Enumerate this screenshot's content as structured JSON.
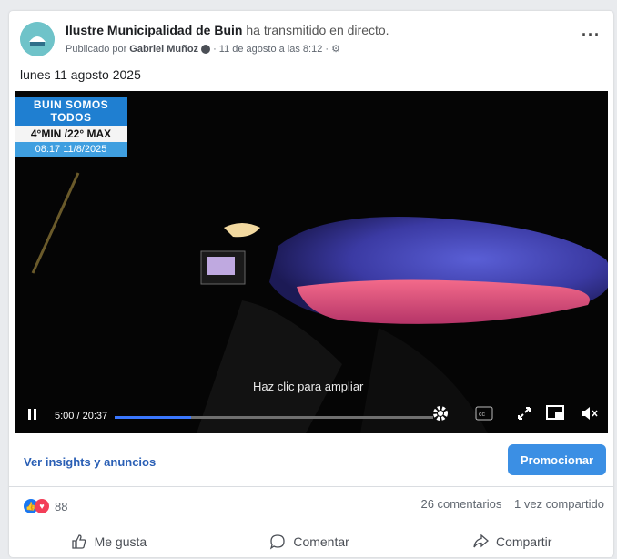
{
  "post": {
    "page_name": "Ilustre Municipalidad de Buin",
    "action": " ha transmitido en directo.",
    "published_by": "Publicado por",
    "author": "Gabriel Muñoz",
    "date": "· 11 de agosto a las 8:12 ·",
    "text": "lunes 11 agosto 2025"
  },
  "video": {
    "overlay_title": "BUIN SOMOS TODOS",
    "overlay_temp": "4°MIN /22° MAX",
    "overlay_datetime": "08:17  11/8/2025",
    "click_hint": "Haz clic para ampliar",
    "time": "5:00 / 20:37",
    "progress": 0.24
  },
  "actions": {
    "insights": "Ver insights y anuncios",
    "promote": "Promocionar",
    "like": "Me gusta",
    "comment": "Comentar",
    "share": "Compartir"
  },
  "stats": {
    "reactions_count": "88",
    "comments": "26 comentarios",
    "shares": "1 vez compartido"
  },
  "colors": {
    "link_blue": "#2a5fb5",
    "button_blue": "#3b8fe4",
    "like_blue": "#1877f2",
    "love_red": "#f33e58"
  }
}
